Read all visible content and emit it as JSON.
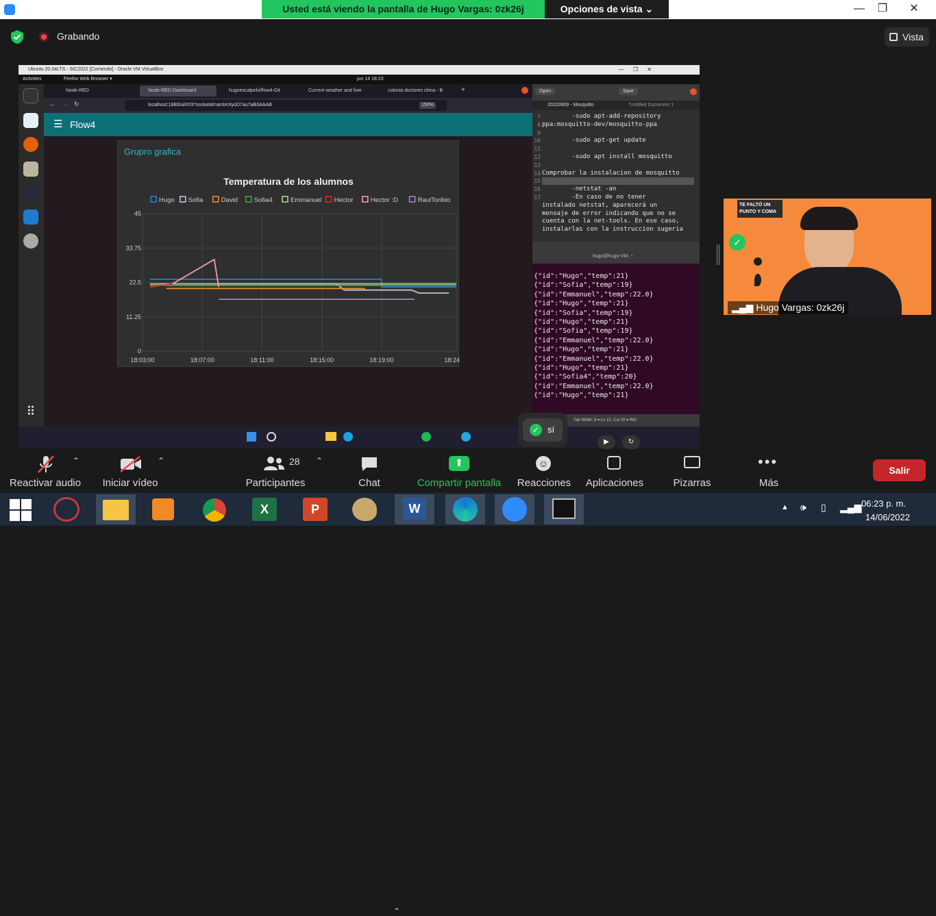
{
  "zoom": {
    "share_banner": "Usted está viendo la pantalla de Hugo Vargas: 0zk26j",
    "view_options": "Opciones de vista ⌄",
    "recording_label": "Grabando",
    "view_button": "Vista",
    "participant_name": "Hugo Vargas: 0zk26j",
    "cam_banner_text": "TE FALTÓ UN PUNTO Y COMA",
    "reaction_label": "sí",
    "toolbar": {
      "mute": "Reactivar audio",
      "video": "Iniciar vídeo",
      "participants": "Participantes",
      "participants_count": "28",
      "chat": "Chat",
      "share": "Compartir pantalla",
      "reactions": "Reacciones",
      "apps": "Aplicaciones",
      "whiteboards": "Pizarras",
      "more": "Más",
      "leave": "Salir"
    }
  },
  "vm": {
    "window_title": "Ubuntu 20.04LTS - SIC2022 [Corriendo] - Oracle VM VirtualBox",
    "activities": "Activities",
    "browser_menu": "Firefox Web Browser ▾",
    "clock": "jun 14  18:23",
    "firefox": {
      "tabs": [
        "Node-RED",
        "Node-RED Dashboard",
        "hugoescalpelo/flow4-Git",
        "Current weather and fore",
        "colonia doctores clima - B"
      ],
      "url": "localhost:1880/ui/#!/3?socketid=amlxUtyoD7au7aB3AAAB",
      "zoom": "150%",
      "dashboard_title": "Flow4",
      "group_title": "Grupro grafica"
    },
    "editor": {
      "open": "Open",
      "save": "Save",
      "file_tab_1": "20220609 - Mosquitto",
      "file_tab_2": "*Untitled Document 1",
      "line_numbers": "7\n\n8\n9\n10\n11\n12\n13\n14\n15\n16\n\n\n\n\n17",
      "text": "        -sudo apt-add-repository\nppa:mosquitto-dev/mosquitto-ppa\n\n        -sudo apt-get update\n\n        -sudo apt install mosquitto\n\nComprobar la instalacion de mosquitto\n\n        -netstat -an\n        -En caso de no tener\ninstalado netstat, aparecerá un\nmensaje de error indicando que no se\ncuenta con la net-tools. En ese caso,\ninstalarlas con la instruccion sugeria",
      "status": "Tab Width: 8 ▾      Ln 15, Col 20 ▾      INS"
    },
    "terminal": {
      "title": "hugo@hugo-VM: ~",
      "lines": "{\"id\":\"Hugo\",\"temp\":21}\n{\"id\":\"Sofia\",\"temp\":19}\n{\"id\":\"Emmanuel\",\"temp\":22.0}\n{\"id\":\"Hugo\",\"temp\":21}\n{\"id\":\"Sofia\",\"temp\":19}\n{\"id\":\"Hugo\",\"temp\":21}\n{\"id\":\"Sofia\",\"temp\":19}\n{\"id\":\"Emmanuel\",\"temp\":22.0}\n{\"id\":\"Hugo\",\"temp\":21}\n{\"id\":\"Emmanuel\",\"temp\":22.0}\n{\"id\":\"Hugo\",\"temp\":21}\n{\"id\":\"Sofia4\",\"temp\":20}\n{\"id\":\"Emmanuel\",\"temp\":22.0}\n{\"id\":\"Hugo\",\"temp\":21}"
    }
  },
  "chart_data": {
    "type": "line",
    "title": "Temperatura de los alumnos",
    "xlim": [
      0,
      21
    ],
    "ylim": [
      0,
      45
    ],
    "yticks": [
      "0",
      "11.25",
      "22.5",
      "33.75",
      "45"
    ],
    "xticks": [
      "18:03:00",
      "18:07:00",
      "18:11:00",
      "18:15:00",
      "18:19:00",
      "18:24:00"
    ],
    "xtick_minutes": [
      0,
      4,
      8,
      12,
      16,
      21
    ],
    "series": [
      {
        "name": "Hugo",
        "color": "#2e7fc4",
        "points": [
          [
            0.5,
            23.5
          ],
          [
            5.5,
            23.5
          ],
          [
            16,
            23.5
          ],
          [
            16,
            21
          ],
          [
            21,
            21
          ]
        ]
      },
      {
        "name": "Sofia",
        "color": "#b9c6e0",
        "points": [
          [
            5,
            22
          ],
          [
            13,
            22
          ],
          [
            13.5,
            20
          ],
          [
            18,
            20
          ],
          [
            18.5,
            19
          ],
          [
            20.5,
            19
          ]
        ]
      },
      {
        "name": "David",
        "color": "#f08c2a",
        "points": [
          [
            1.6,
            20.5
          ],
          [
            14.9,
            20.5
          ]
        ]
      },
      {
        "name": "Sofia4",
        "color": "#3ea742",
        "points": [
          [
            0.5,
            21.5
          ],
          [
            21,
            21.5
          ]
        ]
      },
      {
        "name": "Emmanuel",
        "color": "#a5d98c",
        "points": [
          [
            0.5,
            22
          ],
          [
            21,
            22
          ]
        ]
      },
      {
        "name": "Hector",
        "color": "#d9262b",
        "points": [
          [
            0.5,
            21
          ],
          [
            2,
            22
          ]
        ]
      },
      {
        "name": "Hector :D",
        "color": "#f3a0a5",
        "points": [
          [
            2,
            22
          ],
          [
            4.8,
            30
          ],
          [
            5.1,
            21
          ]
        ]
      },
      {
        "name": "RaulToribio",
        "color": "#a67ed6",
        "points": [
          [
            5.1,
            17
          ],
          [
            18.2,
            17
          ]
        ]
      }
    ]
  },
  "windows": {
    "clock_time": "06:23 p. m.",
    "clock_date": "14/06/2022"
  }
}
